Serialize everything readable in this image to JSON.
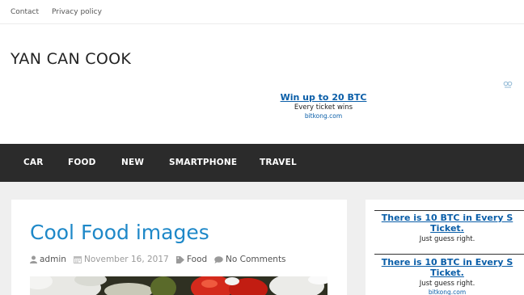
{
  "topbar": {
    "links": [
      {
        "label": "Contact"
      },
      {
        "label": "Privacy policy"
      }
    ]
  },
  "site": {
    "title": "YAN CAN COOK"
  },
  "ad_top": {
    "headline": "Win up to 20 BTC",
    "subline": "Every ticket wins",
    "domain": "bitkong.com",
    "choice_icon": "adchoices-icon"
  },
  "nav": {
    "items": [
      {
        "label": "CAR"
      },
      {
        "label": "FOOD"
      },
      {
        "label": "NEW"
      },
      {
        "label": "SMARTPHONE"
      },
      {
        "label": "TRAVEL"
      }
    ]
  },
  "post": {
    "title": "Cool Food images",
    "author": "admin",
    "date": "November 16, 2017",
    "category": "Food",
    "comments": "No Comments",
    "icons": {
      "author": "user-icon",
      "date": "calendar-icon",
      "category": "tag-icon",
      "comments": "comment-icon"
    }
  },
  "sidebar": {
    "ads": [
      {
        "headline_1": "There is 10 BTC in Every S",
        "headline_2": "Ticket.",
        "subline": "Just guess right.",
        "domain": ""
      },
      {
        "headline_1": "There is 10 BTC in Every S",
        "headline_2": "Ticket.",
        "subline": "Just guess right.",
        "domain": "bitkong.com"
      }
    ]
  },
  "colors": {
    "nav_bg": "#2b2b2b",
    "link_blue": "#1e88c8",
    "ad_blue": "#0a5ea8",
    "content_bg": "#efefef"
  }
}
